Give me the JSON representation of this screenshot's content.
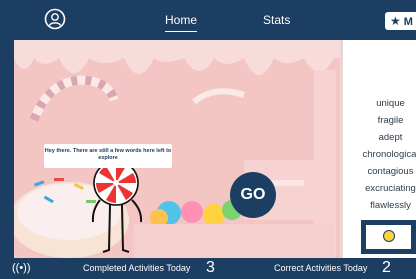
{
  "header": {
    "tabs": [
      {
        "label": "Home",
        "active": true
      },
      {
        "label": "Stats",
        "active": false
      }
    ],
    "more_button": {
      "icon": "star-icon",
      "label": "M"
    }
  },
  "scene": {
    "speech_text": "Hey there. There are still a few words here left to explore",
    "go_label": "GO"
  },
  "word_list": [
    "unique",
    "fragile",
    "adept",
    "chronological",
    "contagious",
    "excruciating",
    "flawlessly"
  ],
  "footer": {
    "completed_label": "Completed Activities Today",
    "completed_value": "3",
    "correct_label": "Correct Activities Today",
    "correct_value": "2"
  },
  "colors": {
    "navy": "#1d3e63",
    "pink": "#f3c6c4",
    "cream": "#f8dcdb"
  }
}
